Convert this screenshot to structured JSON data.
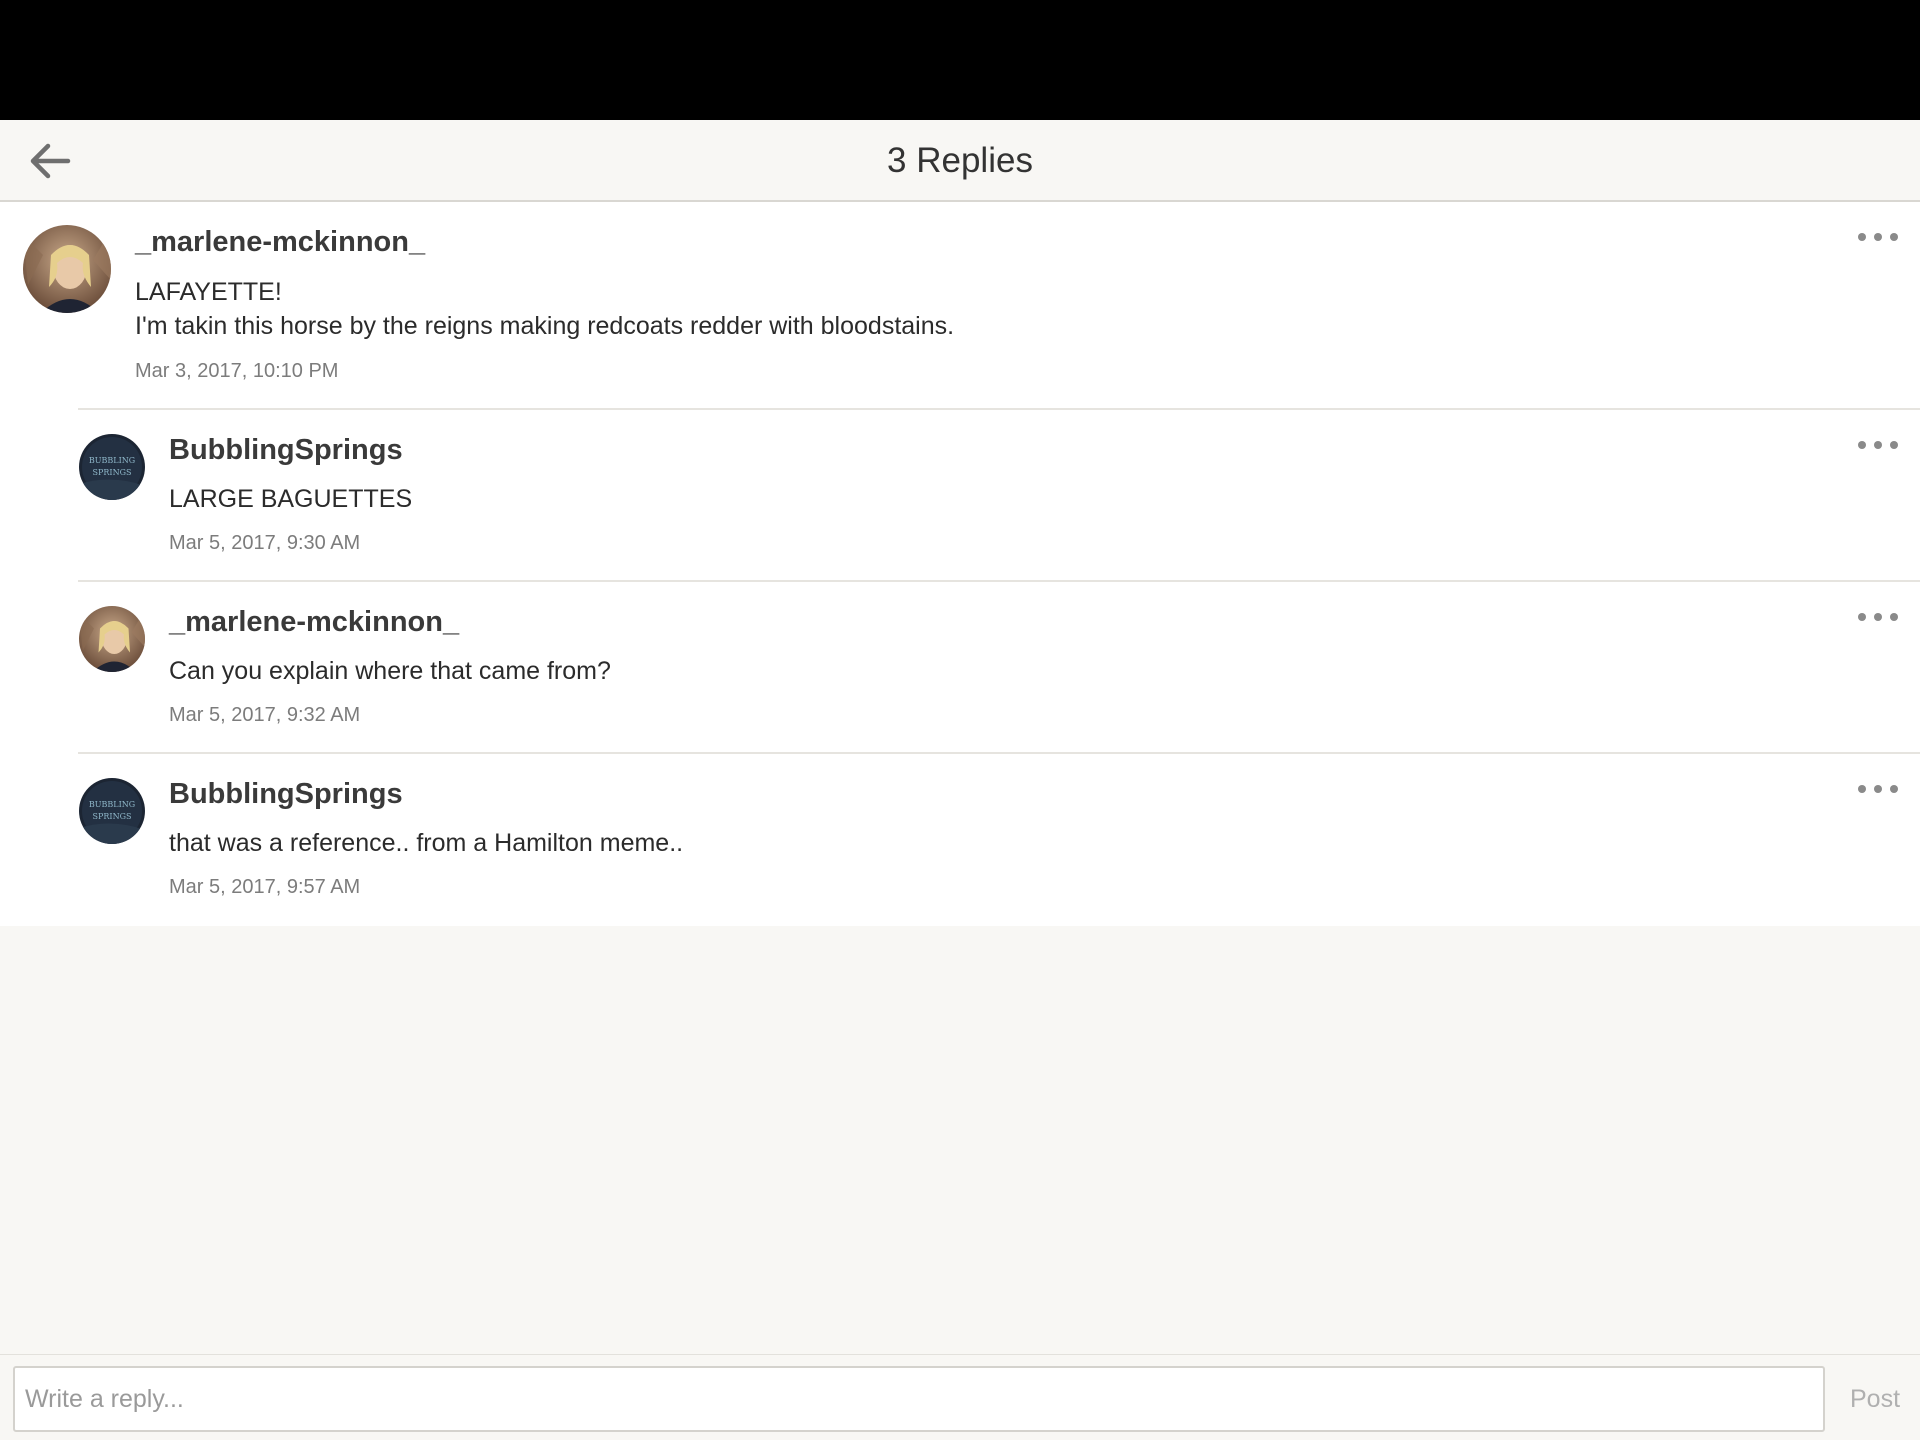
{
  "header": {
    "title": "3 Replies",
    "back_icon": "arrow-left-icon"
  },
  "comments": [
    {
      "username": "_marlene-mckinnon_",
      "lines": [
        "LAFAYETTE!",
        "I'm takin this horse by the reigns making redcoats redder with bloodstains."
      ],
      "timestamp": "Mar 3, 2017, 10:10 PM",
      "avatar": "user-photo-avatar"
    },
    {
      "username": "BubblingSprings",
      "lines": [
        "LARGE BAGUETTES"
      ],
      "timestamp": "Mar 5, 2017, 9:30 AM",
      "avatar": "bubbling-springs-avatar",
      "avatar_text": [
        "BUBBLING",
        "SPRINGS"
      ]
    },
    {
      "username": "_marlene-mckinnon_",
      "lines": [
        "Can you explain where that came from?"
      ],
      "timestamp": "Mar 5, 2017, 9:32 AM",
      "avatar": "user-photo-avatar"
    },
    {
      "username": "BubblingSprings",
      "lines": [
        "that was a reference.. from a Hamilton meme.."
      ],
      "timestamp": "Mar 5, 2017, 9:57 AM",
      "avatar": "bubbling-springs-avatar",
      "avatar_text": [
        "BUBBLING",
        "SPRINGS"
      ]
    }
  ],
  "reply_bar": {
    "placeholder": "Write a reply...",
    "post_label": "Post"
  },
  "colors": {
    "background": "#f8f7f4",
    "status_bar": "#000000",
    "thread_background": "#ffffff",
    "post_disabled": "#b0b0b0"
  }
}
